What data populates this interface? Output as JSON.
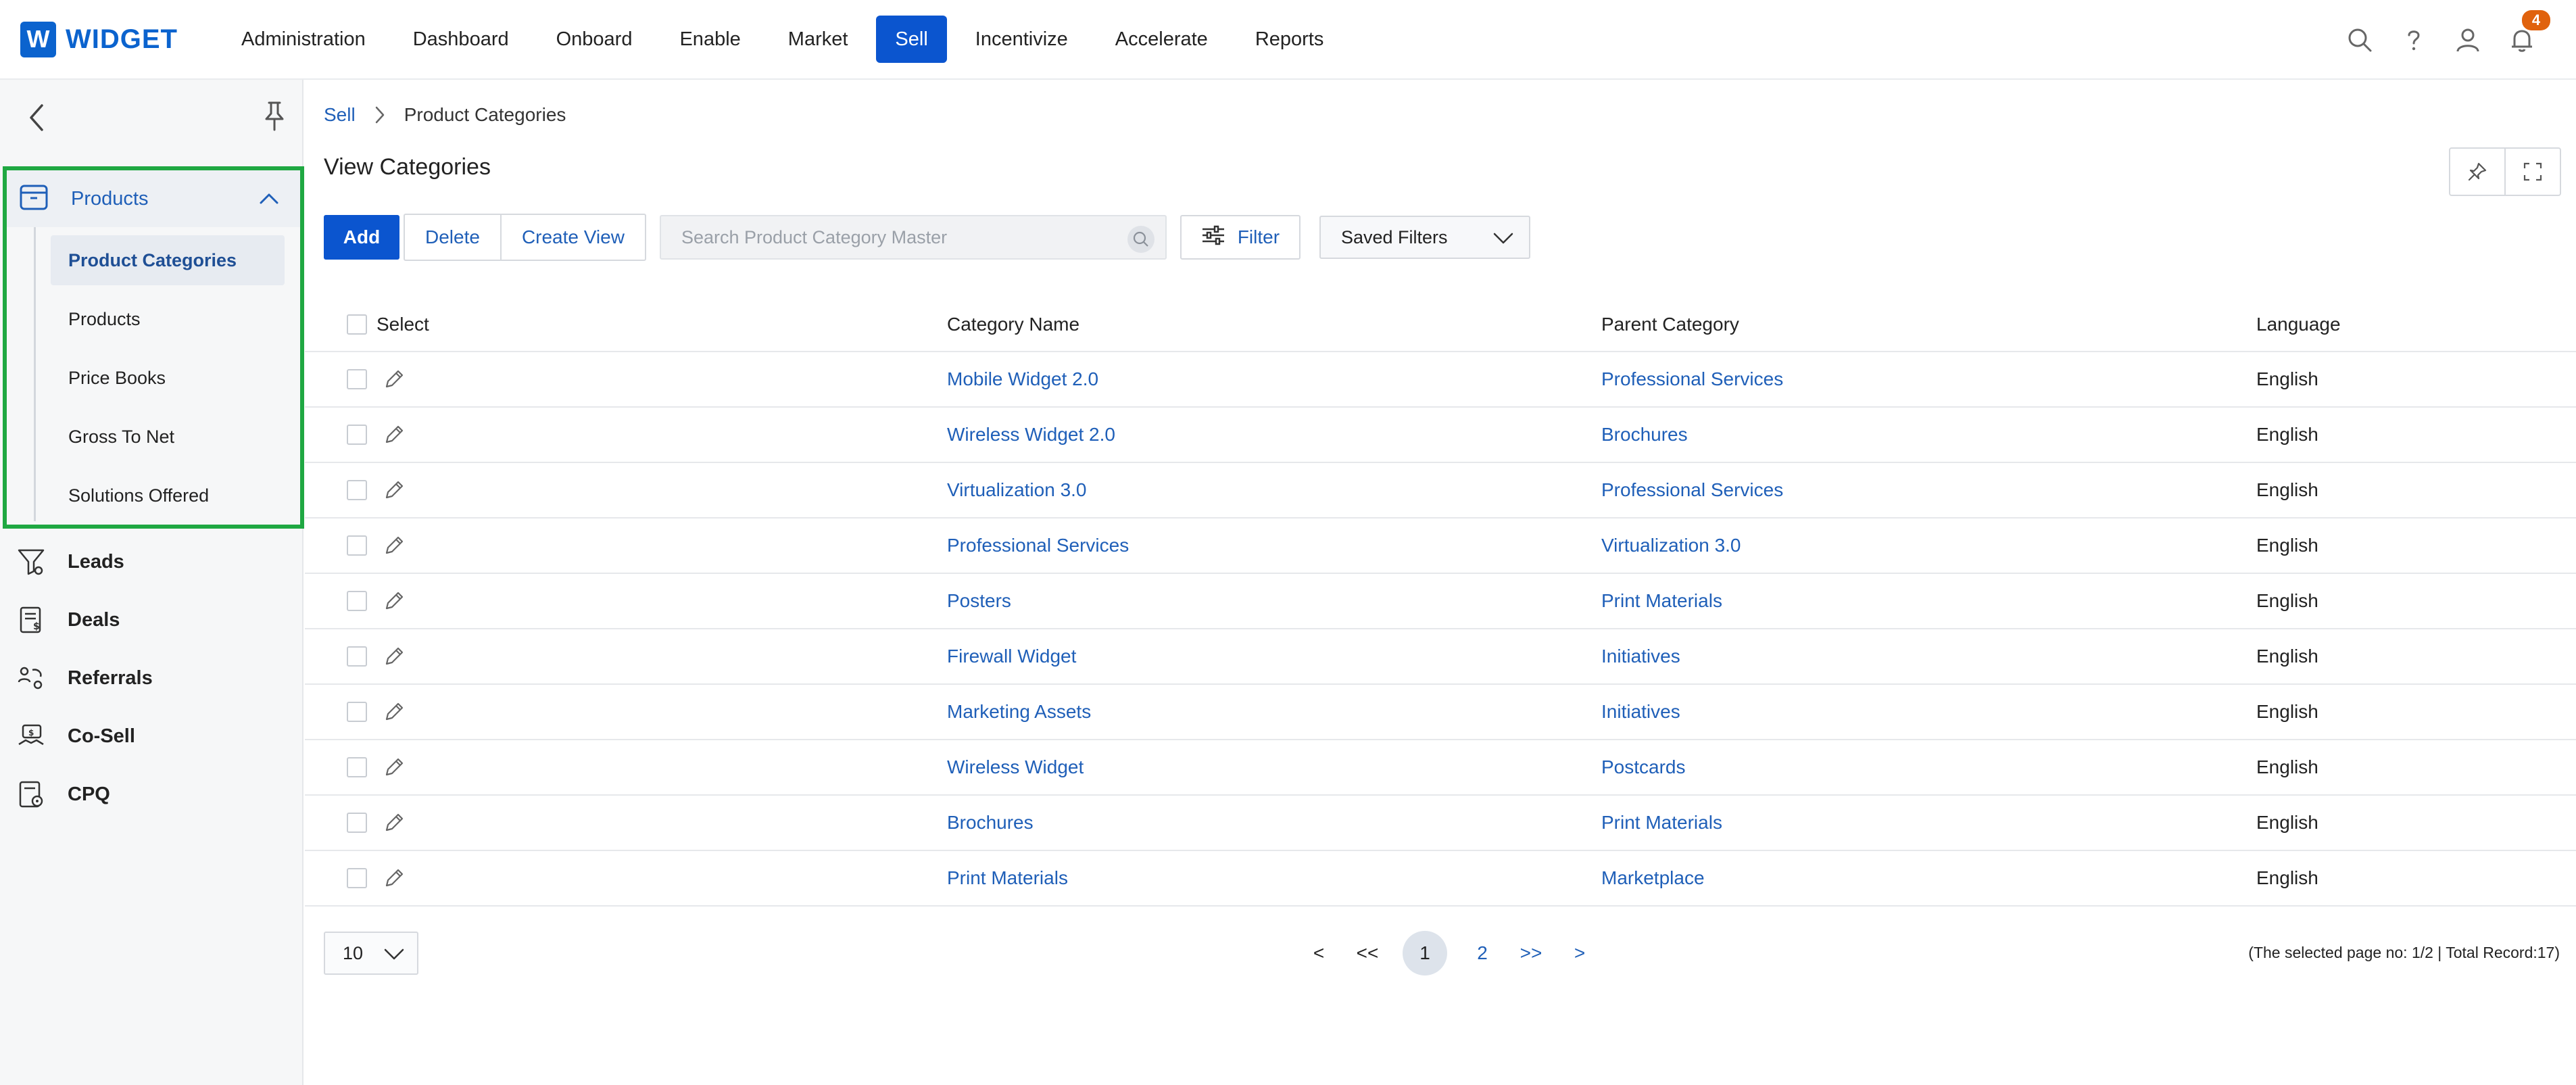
{
  "app": {
    "logo_letter": "W",
    "logo_text": "WIDGET"
  },
  "nav": {
    "items": [
      {
        "label": "Administration"
      },
      {
        "label": "Dashboard"
      },
      {
        "label": "Onboard"
      },
      {
        "label": "Enable"
      },
      {
        "label": "Market"
      },
      {
        "label": "Sell",
        "active": true
      },
      {
        "label": "Incentivize"
      },
      {
        "label": "Accelerate"
      },
      {
        "label": "Reports"
      }
    ],
    "notification_count": "4",
    "icons": [
      "search-icon",
      "help-icon",
      "user-icon",
      "bell-icon"
    ]
  },
  "sidebar": {
    "group": {
      "label": "Products",
      "expanded": true,
      "items": [
        {
          "label": "Product Categories",
          "active": true
        },
        {
          "label": "Products"
        },
        {
          "label": "Price Books"
        },
        {
          "label": "Gross To Net"
        },
        {
          "label": "Solutions Offered"
        }
      ]
    },
    "items": [
      {
        "label": "Leads",
        "icon": "funnel-icon"
      },
      {
        "label": "Deals",
        "icon": "invoice-icon"
      },
      {
        "label": "Referrals",
        "icon": "referral-icon"
      },
      {
        "label": "Co-Sell",
        "icon": "handshake-icon"
      },
      {
        "label": "CPQ",
        "icon": "calculator-icon"
      }
    ]
  },
  "breadcrumb": {
    "parent": "Sell",
    "current": "Product Categories"
  },
  "page": {
    "title": "View Categories"
  },
  "toolbar": {
    "add_label": "Add",
    "delete_label": "Delete",
    "create_view_label": "Create View",
    "search_placeholder": "Search Product Category Master",
    "filter_label": "Filter",
    "saved_filters_label": "Saved Filters"
  },
  "table": {
    "columns": {
      "select": "Select",
      "name": "Category Name",
      "parent": "Parent Category",
      "language": "Language"
    },
    "rows": [
      {
        "name": "Mobile Widget 2.0",
        "parent": "Professional Services",
        "language": "English"
      },
      {
        "name": "Wireless Widget 2.0",
        "parent": "Brochures",
        "language": "English"
      },
      {
        "name": "Virtualization 3.0",
        "parent": "Professional Services",
        "language": "English"
      },
      {
        "name": "Professional Services",
        "parent": "Virtualization 3.0",
        "language": "English"
      },
      {
        "name": "Posters",
        "parent": "Print Materials",
        "language": "English"
      },
      {
        "name": "Firewall Widget",
        "parent": "Initiatives",
        "language": "English"
      },
      {
        "name": "Marketing Assets",
        "parent": "Initiatives",
        "language": "English"
      },
      {
        "name": "Wireless Widget",
        "parent": "Postcards",
        "language": "English"
      },
      {
        "name": "Brochures",
        "parent": "Print Materials",
        "language": "English"
      },
      {
        "name": "Print Materials",
        "parent": "Marketplace",
        "language": "English"
      }
    ]
  },
  "pagination": {
    "page_size": "10",
    "prev": "<",
    "first": "<<",
    "pages": [
      "1",
      "2"
    ],
    "current_page": "1",
    "last": ">>",
    "next": ">",
    "info": "(The selected page no: 1/2 | Total Record:17)"
  },
  "colors": {
    "accent": "#0b55cf",
    "link": "#1f5fb8",
    "highlight_border": "#1fa842",
    "badge": "#e0620d"
  }
}
